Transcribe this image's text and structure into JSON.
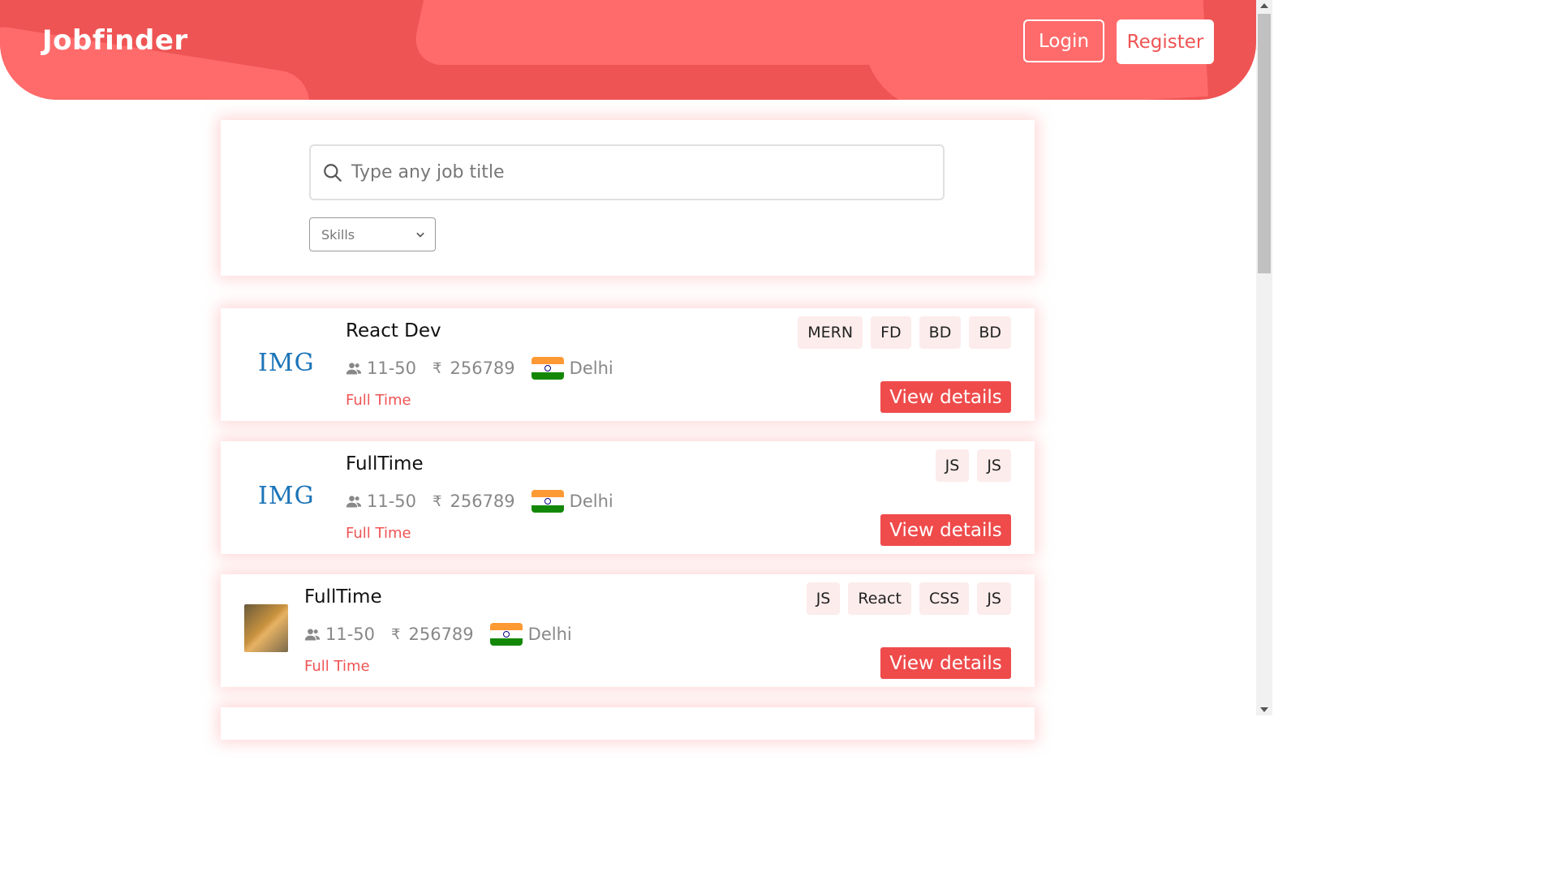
{
  "header": {
    "brand": "Jobfinder",
    "login_label": "Login",
    "register_label": "Register"
  },
  "search": {
    "placeholder": "Type any job title",
    "skills_selected": "Skills"
  },
  "jobs": [
    {
      "logo_text": "IMG",
      "title": "React Dev",
      "company_size": "11-50",
      "currency_symbol": "₹",
      "salary": "256789",
      "location": "Delhi",
      "job_type": "Full Time",
      "skills": [
        "MERN",
        "FD",
        "BD",
        "BD"
      ],
      "view_label": "View details"
    },
    {
      "logo_text": "IMG",
      "title": "FullTime",
      "company_size": "11-50",
      "currency_symbol": "₹",
      "salary": "256789",
      "location": "Delhi",
      "job_type": "Full Time",
      "skills": [
        "JS",
        "JS"
      ],
      "view_label": "View details"
    },
    {
      "title": "FullTime",
      "company_size": "11-50",
      "currency_symbol": "₹",
      "salary": "256789",
      "location": "Delhi",
      "job_type": "Full Time",
      "skills": [
        "JS",
        "React",
        "CSS",
        "JS"
      ],
      "view_label": "View details"
    }
  ],
  "colors": {
    "brand": "#ef5454",
    "button": "#ef4b4b",
    "tag_bg": "#fdecec"
  },
  "icons": {
    "search": "search-icon",
    "users": "users-icon",
    "rupee": "rupee-icon",
    "flag": "india-flag-icon",
    "dropdown": "chevron-down-icon"
  }
}
